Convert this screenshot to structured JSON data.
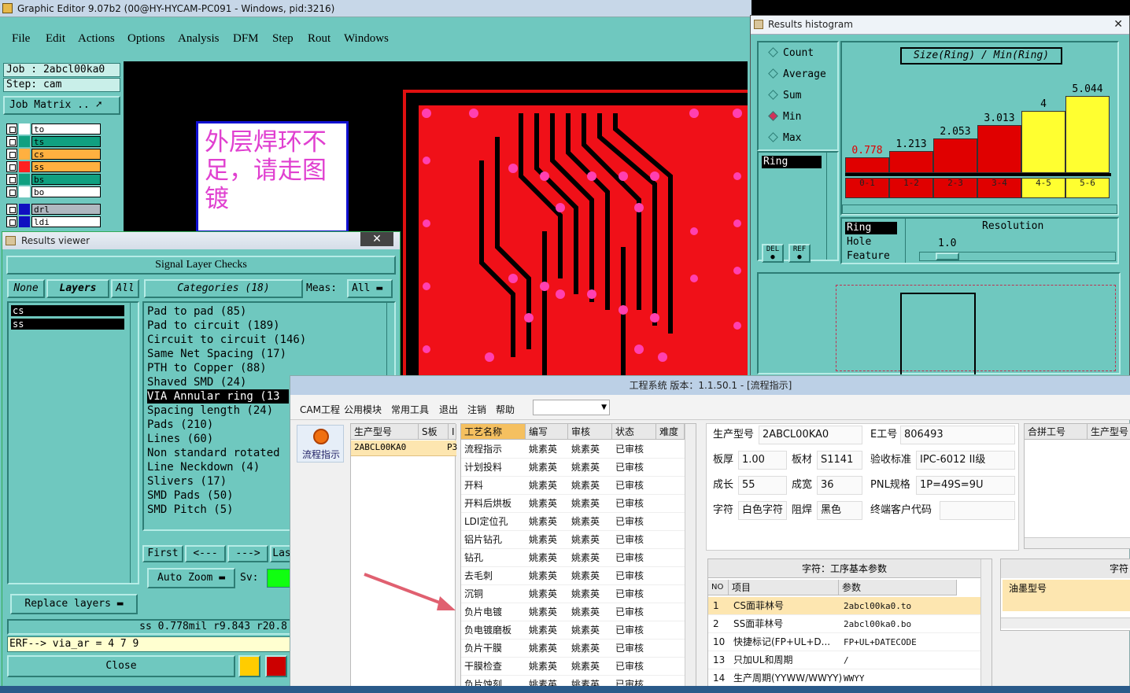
{
  "editor": {
    "title": "Graphic Editor 9.07b2 (00@HY-HYCAM-PC091 - Windows, pid:3216)",
    "menu": [
      "File",
      "Edit",
      "Actions",
      "Options",
      "Analysis",
      "DFM",
      "Step",
      "Rout",
      "Windows"
    ],
    "job_label": "Job : 2abcl00ka0",
    "step_label": "Step: cam",
    "job_matrix": "Job Matrix ..",
    "layers": [
      {
        "name": "to",
        "color": "#ffffff",
        "row": "#ffffff"
      },
      {
        "name": "ts",
        "color": "#10a080",
        "row": "#10a080"
      },
      {
        "name": "cs",
        "color": "#ffb040",
        "row": "#ffb040"
      },
      {
        "name": "ss",
        "color": "#ff2020",
        "row": "#ffb040"
      },
      {
        "name": "bs",
        "color": "#10a080",
        "row": "#10a080"
      },
      {
        "name": "bo",
        "color": "#ffffff",
        "row": "#ffffff"
      },
      {
        "name": "drl",
        "color": "#1010c0",
        "row": "#b0b8c0"
      },
      {
        "name": "ldi",
        "color": "#1010c0",
        "row": "#ffffff"
      }
    ],
    "annotation": "外层焊环不足，请走图镀"
  },
  "results_viewer": {
    "title": "Results viewer",
    "header": "Signal Layer Checks",
    "none": "None",
    "layers_btn": "Layers",
    "all_btn": "All",
    "categories": "Categories (18)",
    "meas_label": "Meas:",
    "meas_value": "All",
    "layer_rows": [
      "cs",
      "ss"
    ],
    "checks": [
      "Pad to pad (85)",
      "Pad to circuit (189)",
      "Circuit to circuit (146)",
      "Same Net Spacing (17)",
      "PTH to Copper (88)",
      "Shaved SMD (24)",
      "VIA Annular ring (13",
      "Spacing length (24)",
      "Pads (210)",
      "Lines (60)",
      "Non standard rotated",
      "Line Neckdown (4)",
      "Slivers (17)",
      "SMD Pads (50)",
      "SMD Pitch (5)"
    ],
    "selected_check": 6,
    "nav": [
      "First",
      "<---",
      "--->",
      "Las"
    ],
    "auto_zoom": "Auto Zoom",
    "sv": "Sv:",
    "replace_layers": "Replace layers",
    "measure": "ss 0.778mil   r9.843   r20.8",
    "erf": "ERF--> via_ar = 4 7 9",
    "close": "Close"
  },
  "histogram": {
    "title": "Results histogram",
    "modes": [
      "Count",
      "Average",
      "Sum",
      "Min",
      "Max"
    ],
    "selected_mode": "Min",
    "formula": "Size(Ring) / Min(Ring)",
    "list_item": "Ring",
    "del": "DEL",
    "ref": "REF",
    "ring_items": [
      "Ring",
      "Hole",
      "Feature"
    ],
    "resolution_label": "Resolution",
    "resolution_value": "1.0",
    "chart_data": {
      "type": "bar",
      "categories": [
        "0-1",
        "1-2",
        "2-3",
        "3-4",
        "4-5",
        "5-6"
      ],
      "values": [
        0.778,
        1.213,
        2.053,
        3.013,
        4,
        5.044
      ],
      "colors": [
        "#e00000",
        "#e00000",
        "#e00000",
        "#e00000",
        "#ffff30",
        "#ffff30"
      ],
      "ylim": [
        0,
        5.5
      ]
    }
  },
  "cam": {
    "title": "工程系统   版本：1.1.50.1 - [流程指示]",
    "toolbar": [
      "CAM工程",
      "公用模块",
      "常用工具",
      "退出",
      "注销",
      "帮助"
    ],
    "side_button": "流程指示",
    "left_grid_headers": [
      "生产型号",
      "S板",
      "I"
    ],
    "left_grid_row": [
      "2ABCL00KA0",
      "P3"
    ],
    "grid_headers": [
      "工艺名称",
      "编写",
      "审核",
      "状态",
      "难度"
    ],
    "grid_rows": [
      [
        "流程指示",
        "姚素英",
        "姚素英",
        "已审核"
      ],
      [
        "计划投料",
        "姚素英",
        "姚素英",
        "已审核"
      ],
      [
        "开料",
        "姚素英",
        "姚素英",
        "已审核"
      ],
      [
        "开料后烘板",
        "姚素英",
        "姚素英",
        "已审核"
      ],
      [
        "LDI定位孔",
        "姚素英",
        "姚素英",
        "已审核"
      ],
      [
        "铝片钻孔",
        "姚素英",
        "姚素英",
        "已审核"
      ],
      [
        "钻孔",
        "姚素英",
        "姚素英",
        "已审核"
      ],
      [
        "去毛刺",
        "姚素英",
        "姚素英",
        "已审核"
      ],
      [
        "沉铜",
        "姚素英",
        "姚素英",
        "已审核"
      ],
      [
        "负片电镀",
        "姚素英",
        "姚素英",
        "已审核"
      ],
      [
        "负电镀磨板",
        "姚素英",
        "姚素英",
        "已审核"
      ],
      [
        "负片干膜",
        "姚素英",
        "姚素英",
        "已审核"
      ],
      [
        "干膜检查",
        "姚素英",
        "姚素英",
        "已审核"
      ],
      [
        "负片蚀刻",
        "姚素英",
        "姚素英",
        "已审核"
      ]
    ],
    "info": {
      "model_label": "生产型号",
      "model": "2ABCL00KA0",
      "e_label": "E工号",
      "e": "806493",
      "thick_label": "板厚",
      "thick": "1.00",
      "mat_label": "板材",
      "mat": "S1141",
      "std_label": "验收标准",
      "std": "IPC-6012 II级",
      "len_label": "成长",
      "len": "55",
      "wid_label": "成宽",
      "wid": "36",
      "pnl_label": "PNL规格",
      "pnl": "1P=49S=9U",
      "char_label": "字符",
      "char": "白色字符",
      "mask_label": "阻焊",
      "mask": "黑色",
      "cust_label": "终端客户代码",
      "cust": ""
    },
    "merge_headers": [
      "合拼工号",
      "生产型号"
    ],
    "params_title": "字符：工序基本参数",
    "params_headers": [
      "NO",
      "项目",
      "参数"
    ],
    "params_rows": [
      [
        "1",
        "CS面菲林号",
        "2abcl00ka0.to"
      ],
      [
        "2",
        "SS面菲林号",
        "2abcl00ka0.bo"
      ],
      [
        "10",
        "快捷标记(FP+UL+D...",
        "FP+UL+DATECODE"
      ],
      [
        "13",
        "只加UL和周期",
        "/"
      ],
      [
        "14",
        "生产周期(YYWW/WWYY)",
        "WWYY"
      ]
    ],
    "right_panel_title": "字符",
    "ink_label": "油墨型号"
  }
}
